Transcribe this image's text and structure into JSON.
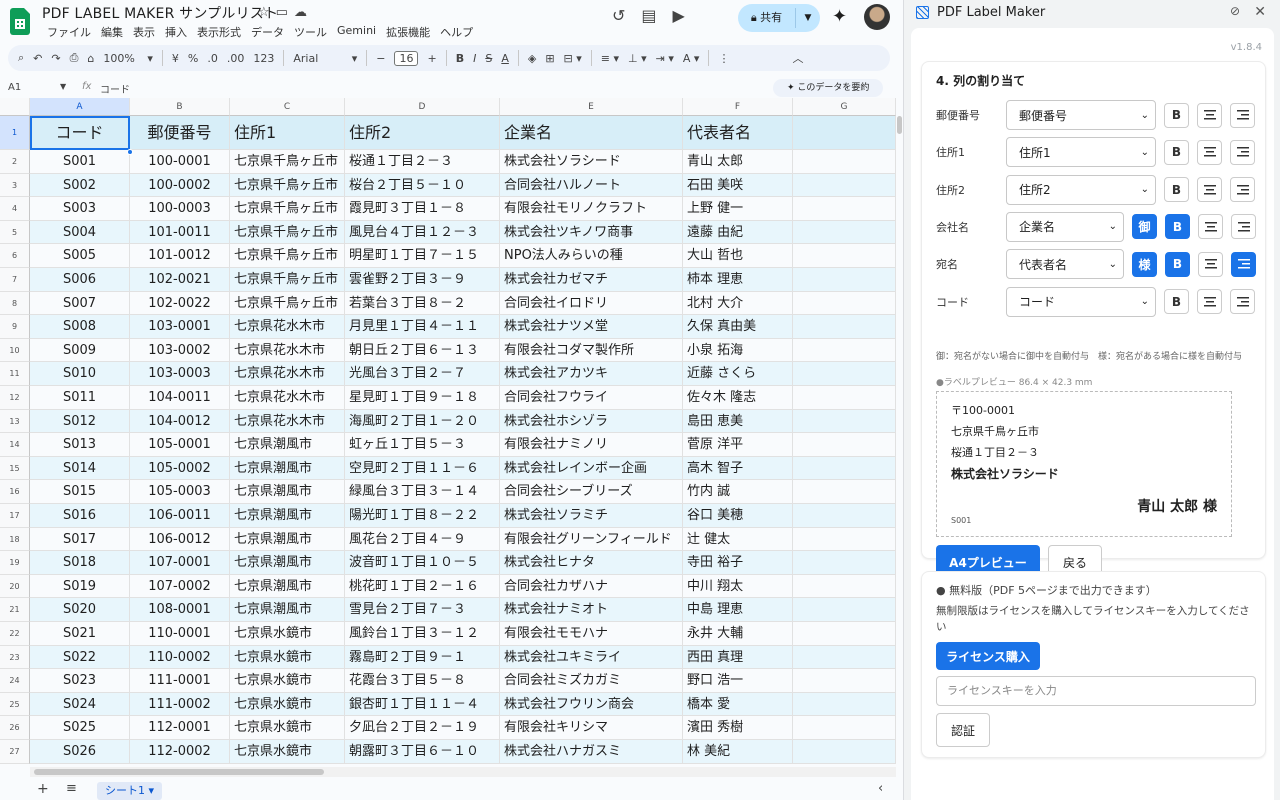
{
  "app": {
    "title": "PDF LABEL MAKER サンプルリスト",
    "menus": [
      "ファイル",
      "編集",
      "表示",
      "挿入",
      "表示形式",
      "データ",
      "ツール",
      "Gemini",
      "拡張機能",
      "ヘルプ"
    ],
    "share_label": "共有",
    "accent": "#1a73e8"
  },
  "toolbar": {
    "zoom": "100%",
    "currency": "¥",
    "percent": "%",
    "dec_dec": ".0",
    "dec_inc": ".00",
    "num_fmt": "123",
    "font": "Arial",
    "font_size": "16"
  },
  "formula": {
    "cell_ref": "A1",
    "fx": "fx",
    "value": "コード",
    "summarize": "このデータを要約"
  },
  "columns": [
    "A",
    "B",
    "C",
    "D",
    "E",
    "F",
    "G"
  ],
  "header_row": [
    "コード",
    "郵便番号",
    "住所1",
    "住所2",
    "企業名",
    "代表者名",
    ""
  ],
  "rows": [
    [
      "S001",
      "100-0001",
      "七京県千鳥ヶ丘市",
      "桜通１丁目２－３",
      "株式会社ソラシード",
      "青山 太郎"
    ],
    [
      "S002",
      "100-0002",
      "七京県千鳥ヶ丘市",
      "桜台２丁目５－１０",
      "合同会社ハルノート",
      "石田 美咲"
    ],
    [
      "S003",
      "100-0003",
      "七京県千鳥ヶ丘市",
      "霞見町３丁目１－８",
      "有限会社モリノクラフト",
      "上野 健一"
    ],
    [
      "S004",
      "101-0011",
      "七京県千鳥ヶ丘市",
      "風見台４丁目１２－３",
      "株式会社ツキノワ商事",
      "遠藤 由紀"
    ],
    [
      "S005",
      "101-0012",
      "七京県千鳥ヶ丘市",
      "明星町１丁目７－１５",
      "NPO法人みらいの種",
      "大山 哲也"
    ],
    [
      "S006",
      "102-0021",
      "七京県千鳥ヶ丘市",
      "雲雀野２丁目３－９",
      "株式会社カゼマチ",
      "柿本 理恵"
    ],
    [
      "S007",
      "102-0022",
      "七京県千鳥ヶ丘市",
      "若葉台３丁目８－２",
      "合同会社イロドリ",
      "北村 大介"
    ],
    [
      "S008",
      "103-0001",
      "七京県花水木市",
      "月見里１丁目４－１１",
      "株式会社ナツメ堂",
      "久保 真由美"
    ],
    [
      "S009",
      "103-0002",
      "七京県花水木市",
      "朝日丘２丁目６－１３",
      "有限会社コダマ製作所",
      "小泉 拓海"
    ],
    [
      "S010",
      "103-0003",
      "七京県花水木市",
      "光風台３丁目２－７",
      "株式会社アカツキ",
      "近藤 さくら"
    ],
    [
      "S011",
      "104-0011",
      "七京県花水木市",
      "星見町１丁目９－１８",
      "合同会社フウライ",
      "佐々木 隆志"
    ],
    [
      "S012",
      "104-0012",
      "七京県花水木市",
      "海風町２丁目１－２０",
      "株式会社ホシゾラ",
      "島田 恵美"
    ],
    [
      "S013",
      "105-0001",
      "七京県潮風市",
      "虹ヶ丘１丁目５－３",
      "有限会社ナミノリ",
      "菅原 洋平"
    ],
    [
      "S014",
      "105-0002",
      "七京県潮風市",
      "空見町２丁目１１－６",
      "株式会社レインボー企画",
      "高木 智子"
    ],
    [
      "S015",
      "105-0003",
      "七京県潮風市",
      "緑風台３丁目３－１４",
      "合同会社シーブリーズ",
      "竹内 誠"
    ],
    [
      "S016",
      "106-0011",
      "七京県潮風市",
      "陽光町１丁目８－２２",
      "株式会社ソラミチ",
      "谷口 美穂"
    ],
    [
      "S017",
      "106-0012",
      "七京県潮風市",
      "風花台２丁目４－９",
      "有限会社グリーンフィールド",
      "辻 健太"
    ],
    [
      "S018",
      "107-0001",
      "七京県潮風市",
      "波音町１丁目１０－５",
      "株式会社ヒナタ",
      "寺田 裕子"
    ],
    [
      "S019",
      "107-0002",
      "七京県潮風市",
      "桃花町１丁目２－１６",
      "合同会社カザハナ",
      "中川 翔太"
    ],
    [
      "S020",
      "108-0001",
      "七京県潮風市",
      "雪見台２丁目７－３",
      "株式会社ナミオト",
      "中島 理恵"
    ],
    [
      "S021",
      "110-0001",
      "七京県水鏡市",
      "風鈴台１丁目３－１２",
      "有限会社モモハナ",
      "永井 大輔"
    ],
    [
      "S022",
      "110-0002",
      "七京県水鏡市",
      "霧島町２丁目９－１",
      "株式会社ユキミライ",
      "西田 真理"
    ],
    [
      "S023",
      "111-0001",
      "七京県水鏡市",
      "花霞台３丁目５－８",
      "合同会社ミズカガミ",
      "野口 浩一"
    ],
    [
      "S024",
      "111-0002",
      "七京県水鏡市",
      "銀杏町１丁目１１－４",
      "株式会社フウリン商会",
      "橋本 愛"
    ],
    [
      "S025",
      "112-0001",
      "七京県水鏡市",
      "夕凪台２丁目２－１９",
      "有限会社キリシマ",
      "濱田 秀樹"
    ],
    [
      "S026",
      "112-0002",
      "七京県水鏡市",
      "朝露町３丁目６－１０",
      "株式会社ハナガスミ",
      "林 美紀"
    ]
  ],
  "row_numbers": [
    "1",
    "2",
    "3",
    "4",
    "5",
    "6",
    "7",
    "8",
    "9",
    "10",
    "11",
    "12",
    "13",
    "14",
    "15",
    "16",
    "17",
    "18",
    "19",
    "20",
    "21",
    "22",
    "23",
    "24",
    "25",
    "26",
    "27"
  ],
  "sheet": {
    "tab": "シート1"
  },
  "panel": {
    "title": "PDF Label Maker",
    "version": "v1.8.4",
    "section": "4. 列の割り当て",
    "mappings": [
      {
        "label": "郵便番号",
        "value": "郵便番号",
        "suffix": "",
        "bold": false,
        "align": "center"
      },
      {
        "label": "住所1",
        "value": "住所1",
        "suffix": "",
        "bold": false,
        "align": "center"
      },
      {
        "label": "住所2",
        "value": "住所2",
        "suffix": "",
        "bold": false,
        "align": "center"
      },
      {
        "label": "会社名",
        "value": "企業名",
        "suffix": "御",
        "bold": true,
        "align": "center"
      },
      {
        "label": "宛名",
        "value": "代表者名",
        "suffix": "様",
        "bold": true,
        "align": "right"
      },
      {
        "label": "コード",
        "value": "コード",
        "suffix": "",
        "bold": false,
        "align": "center"
      }
    ],
    "bold_glyph": "B",
    "note": "御：宛名がない場合に御中を自動付与　様：宛名がある場合に様を自動付与",
    "preview_label": "●ラベルプレビュー 86.4 × 42.3 mm",
    "preview": {
      "postal": "〒100-0001",
      "addr1": "七京県千鳥ヶ丘市",
      "addr2": "桜通１丁目２－３",
      "company": "株式会社ソラシード",
      "name": "青山 太郎 様",
      "code": "S001"
    },
    "a4_button": "A4プレビュー",
    "back_button": "戻る",
    "free_title": "● 無料版（PDF 5ページまで出力できます）",
    "free_desc": "無制限版はライセンスを購入してライセンスキーを入力してください",
    "buy_button": "ライセンス購入",
    "license_placeholder": "ライセンスキーを入力",
    "verify_button": "認証"
  }
}
